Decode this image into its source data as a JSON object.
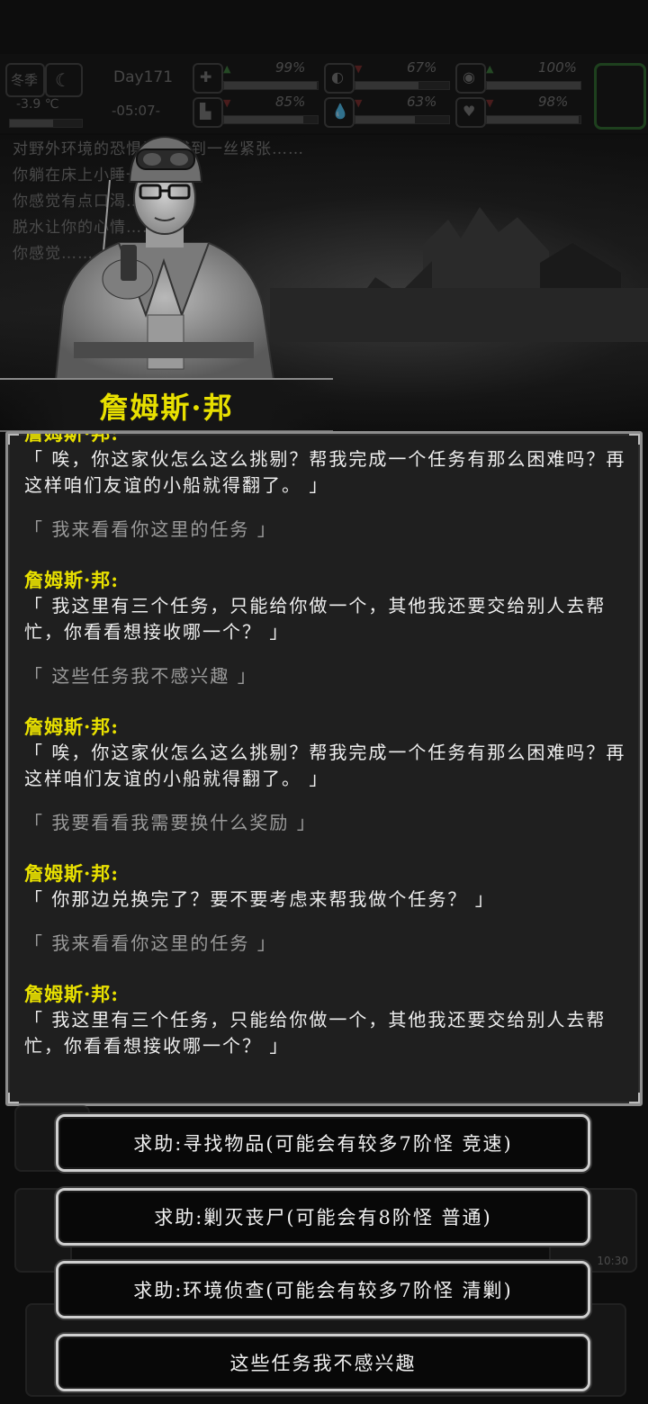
{
  "hud": {
    "season": "冬季",
    "temperature": "-3.9 ℃",
    "day": "Day171",
    "time": "-05:07-",
    "stats": [
      {
        "name": "health",
        "icon": "medkit-icon",
        "value": "99%",
        "level": 0.99,
        "trend": "up"
      },
      {
        "name": "food",
        "icon": "stomach-icon",
        "value": "67%",
        "level": 0.67,
        "trend": "down"
      },
      {
        "name": "sanity",
        "icon": "brain-icon",
        "value": "100%",
        "level": 1.0,
        "trend": "up"
      },
      {
        "name": "stamina",
        "icon": "boot-icon",
        "value": "85%",
        "level": 0.85,
        "trend": "down"
      },
      {
        "name": "water",
        "icon": "water-drop-icon",
        "value": "63%",
        "level": 0.63,
        "trend": "down"
      },
      {
        "name": "mood",
        "icon": "heart-icon",
        "value": "98%",
        "level": 0.98,
        "trend": "down"
      }
    ]
  },
  "background_log": [
    "对野外环境的恐惧让你感到一丝紧张……",
    "你躺在床上小睡一会儿，",
    "你感觉有点口渴……",
    "脱水让你的心情……",
    "你感觉……"
  ],
  "npc": {
    "name": "詹姆斯·邦"
  },
  "dialog": [
    {
      "speaker": "詹姆斯·邦:",
      "text": "「 唉，你这家伙怎么这么挑剔？帮我完成一个任务有那么困难吗？再这样咱们友谊的小船就得翻了。 」",
      "reply": "「 我来看看你这里的任务 」"
    },
    {
      "speaker": "詹姆斯·邦:",
      "text": "「 我这里有三个任务，只能给你做一个，其他我还要交给别人去帮忙，你看看想接收哪一个？ 」",
      "reply": "「 这些任务我不感兴趣 」"
    },
    {
      "speaker": "詹姆斯·邦:",
      "text": "「 唉，你这家伙怎么这么挑剔？帮我完成一个任务有那么困难吗？再这样咱们友谊的小船就得翻了。 」",
      "reply": "「 我要看看我需要换什么奖励 」"
    },
    {
      "speaker": "詹姆斯·邦:",
      "text": "「 你那边兑换完了？要不要考虑来帮我做个任务？ 」",
      "reply": "「 我来看看你这里的任务 」"
    },
    {
      "speaker": "詹姆斯·邦:",
      "text": "「 我这里有三个任务，只能给你做一个，其他我还要交给别人去帮忙，你看看想接收哪一个？ 」",
      "reply": ""
    }
  ],
  "choices": [
    "求助:寻找物品(可能会有较多7阶怪 竞速)",
    "求助:剿灭丧尸(可能会有8阶怪 普通)",
    "求助:环境侦查(可能会有较多7阶怪 清剿)",
    "这些任务我不感兴趣"
  ],
  "bottom_clock": "10:30"
}
